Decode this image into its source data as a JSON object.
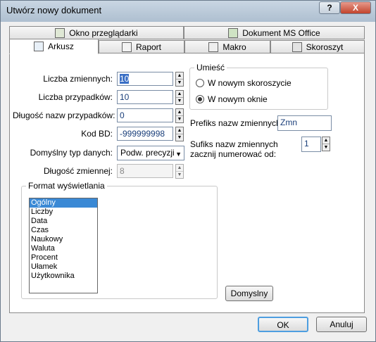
{
  "window": {
    "title": "Utwórz nowy dokument",
    "help_label": "?",
    "close_label": "X"
  },
  "tabs": {
    "row1": [
      {
        "label": "Okno przeglądarki"
      },
      {
        "label": "Dokument MS Office"
      }
    ],
    "row2": [
      {
        "label": "Arkusz"
      },
      {
        "label": "Raport"
      },
      {
        "label": "Makro"
      },
      {
        "label": "Skoroszyt"
      }
    ],
    "active": "Arkusz"
  },
  "form": {
    "num_vars_label": "Liczba zmiennych:",
    "num_vars_value": "10",
    "num_cases_label": "Liczba przypadków:",
    "num_cases_value": "10",
    "case_name_len_label": "Długość nazw przypadków:",
    "case_name_len_value": "0",
    "md_code_label": "Kod BD:",
    "md_code_value": "-999999998",
    "default_type_label": "Domyślny typ danych:",
    "default_type_value": "Podw. precyzji",
    "var_length_label": "Długość zmiennej:",
    "var_length_value": "8"
  },
  "placement": {
    "title": "Umieść",
    "options": [
      {
        "label": "W nowym skoroszycie",
        "selected": false
      },
      {
        "label": "W nowym oknie",
        "selected": true
      }
    ]
  },
  "prefix": {
    "label": "Prefiks nazw zmiennych:",
    "value": "Zmn"
  },
  "suffix": {
    "label": "Sufiks nazw zmiennych zacznij numerować od:",
    "value": "1"
  },
  "display_format": {
    "title": "Format wyświetlania",
    "items": [
      "Ogólny",
      "Liczby",
      "Data",
      "Czas",
      "Naukowy",
      "Waluta",
      "Procent",
      "Ułamek",
      "Użytkownika"
    ],
    "selected": "Ogólny"
  },
  "buttons": {
    "default_label": "Domyslny",
    "ok_label": "OK",
    "cancel_label": "Anuluj"
  }
}
